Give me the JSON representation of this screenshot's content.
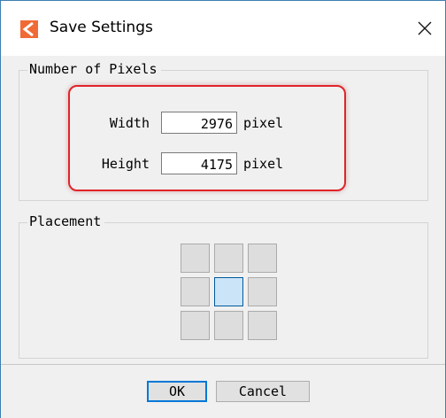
{
  "window": {
    "title": "Save Settings",
    "close_glyph": "✕"
  },
  "icons": {
    "app_icon": "app-logo-icon",
    "close_icon": "close-icon",
    "app_icon_color": "#f06a35"
  },
  "pixels_group": {
    "legend": "Number of Pixels",
    "width": {
      "label": "Width",
      "value": "2976",
      "unit": "pixel"
    },
    "height": {
      "label": "Height",
      "value": "4175",
      "unit": "pixel"
    }
  },
  "placement_group": {
    "legend": "Placement",
    "grid_rows": 3,
    "grid_cols": 3,
    "selected_cell": "middle-center"
  },
  "buttons": {
    "ok": "OK",
    "cancel": "Cancel"
  },
  "colors": {
    "highlight": "#e0242a",
    "selected_cell": "#cce4f7",
    "ok_border": "#0078d7"
  }
}
